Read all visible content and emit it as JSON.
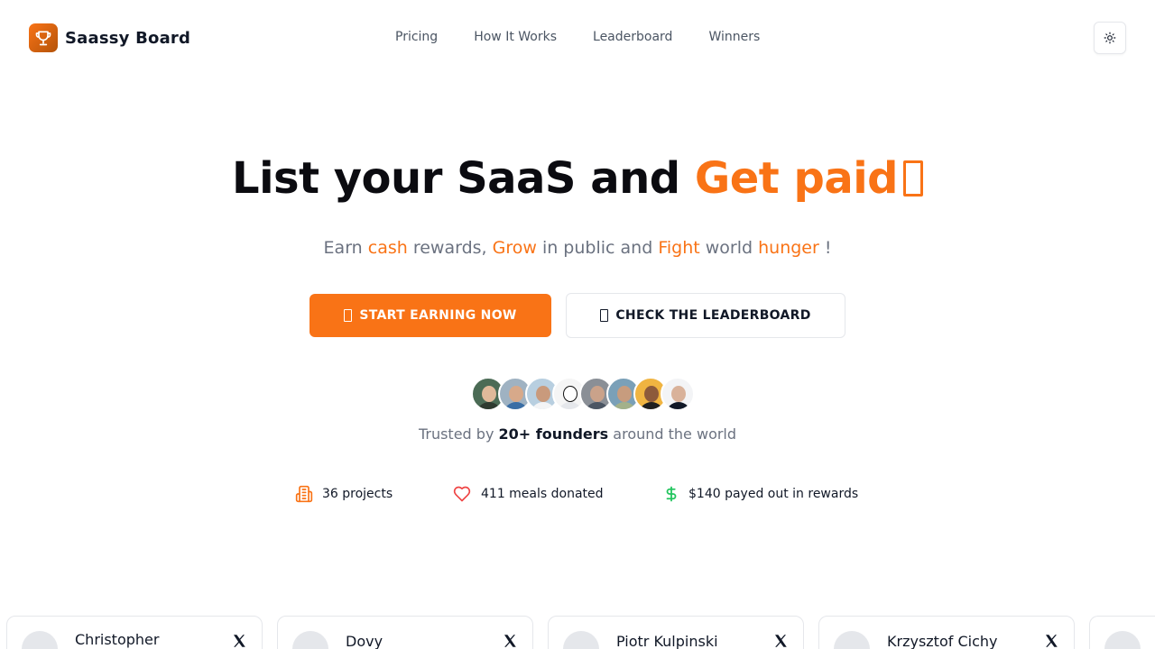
{
  "brand": {
    "name": "Saassy Board",
    "logo_icon": "trophy-icon"
  },
  "nav": {
    "items": [
      {
        "label": "Pricing"
      },
      {
        "label": "How It Works"
      },
      {
        "label": "Leaderboard"
      },
      {
        "label": "Winners"
      }
    ],
    "theme_icon": "sun-icon"
  },
  "hero": {
    "title_part1": "List your SaaS and ",
    "title_highlight": "Get paid",
    "subtitle": {
      "t1": "Earn ",
      "h1": "cash",
      "t2": " rewards, ",
      "h2": "Grow",
      "t3": " in public and ",
      "h3": "Fight",
      "t4": " world ",
      "h4": "hunger",
      "t5": " !"
    }
  },
  "cta": {
    "primary_label": "START EARNING NOW",
    "secondary_label": "CHECK THE LEADERBOARD"
  },
  "social_proof": {
    "prefix": "Trusted by ",
    "highlight": "20+ founders",
    "suffix": " around the world",
    "avatar_count": 8
  },
  "stats": [
    {
      "icon": "building-icon",
      "text": "36 projects"
    },
    {
      "icon": "heart-icon",
      "text": "411 meals donated"
    },
    {
      "icon": "dollar-icon",
      "text": "$140 payed out in rewards"
    }
  ],
  "founders": [
    {
      "name": "Christopher"
    },
    {
      "name": "Dovy"
    },
    {
      "name": "Piotr Kulpinski"
    },
    {
      "name": "Krzysztof Cichy"
    }
  ],
  "colors": {
    "accent": "#f97316",
    "text": "#111827",
    "muted": "#6b7280",
    "border": "#e5e7eb",
    "stat_building": "#f97316",
    "stat_heart": "#ef4444",
    "stat_dollar": "#22c55e"
  }
}
